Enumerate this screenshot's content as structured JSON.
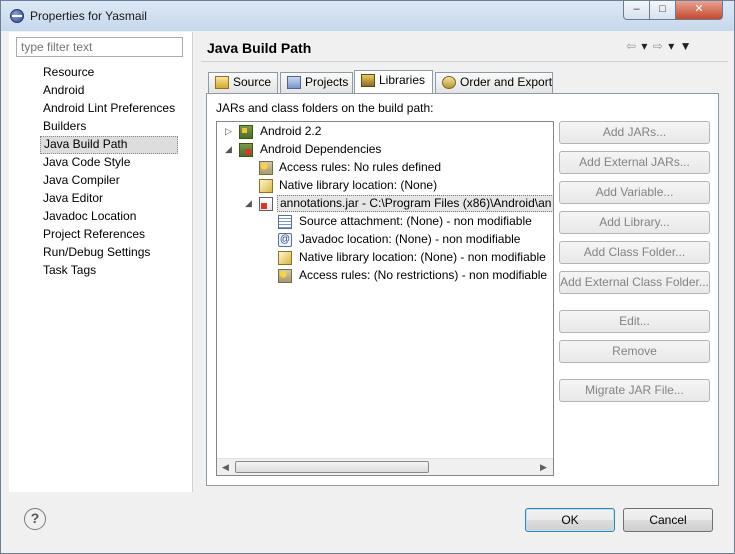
{
  "window": {
    "title": "Properties for Yasmail",
    "controls": {
      "minimize": "–",
      "maximize": "□",
      "close": "✕"
    }
  },
  "filter": {
    "placeholder": "type filter text"
  },
  "nav": {
    "items": [
      "Resource",
      "Android",
      "Android Lint Preferences",
      "Builders",
      "Java Build Path",
      "Java Code Style",
      "Java Compiler",
      "Java Editor",
      "Javadoc Location",
      "Project References",
      "Run/Debug Settings",
      "Task Tags"
    ],
    "selected": "Java Build Path"
  },
  "page": {
    "title": "Java Build Path",
    "nav_arrows": {
      "back": "⇦",
      "back_menu": "▾",
      "forward": "⇨",
      "forward_menu": "▾",
      "menu": "▼"
    }
  },
  "tabs": [
    {
      "label": "Source",
      "icon": "source-folder-icon"
    },
    {
      "label": "Projects",
      "icon": "projects-icon"
    },
    {
      "label": "Libraries",
      "icon": "libraries-icon",
      "active": true
    },
    {
      "label": "Order and Export",
      "icon": "order-export-icon"
    }
  ],
  "libraries": {
    "label": "JARs and class folders on the build path:",
    "tree": [
      {
        "text": "Android 2.2",
        "icon": "library-icon",
        "toggle": "▷"
      },
      {
        "text": "Android Dependencies",
        "icon": "library-dependency-icon",
        "toggle": "◢"
      },
      {
        "text": "Access rules: No rules defined",
        "icon": "access-rules-icon"
      },
      {
        "text": "Native library location: (None)",
        "icon": "native-library-icon"
      },
      {
        "text": "annotations.jar - C:\\Program Files (x86)\\Android\\an",
        "icon": "jar-file-icon",
        "toggle": "◢"
      },
      {
        "text": "Source attachment: (None) - non modifiable",
        "icon": "source-attachment-icon"
      },
      {
        "text": "Javadoc location: (None) - non modifiable",
        "icon": "javadoc-icon"
      },
      {
        "text": "Native library location: (None) - non modifiable",
        "icon": "native-library-icon"
      },
      {
        "text": "Access rules: (No restrictions) - non modifiable",
        "icon": "access-rules-icon"
      }
    ],
    "scroll": {
      "left": "◀",
      "right": "▶"
    },
    "buttons": {
      "add_jars": "Add JARs...",
      "add_external_jars": "Add External JARs...",
      "add_variable": "Add Variable...",
      "add_library": "Add Library...",
      "add_class_folder": "Add Class Folder...",
      "add_external_class_folder": "Add External Class Folder...",
      "edit": "Edit...",
      "remove": "Remove",
      "migrate_jar": "Migrate JAR File..."
    }
  },
  "footer": {
    "help": "?",
    "ok": "OK",
    "cancel": "Cancel"
  }
}
